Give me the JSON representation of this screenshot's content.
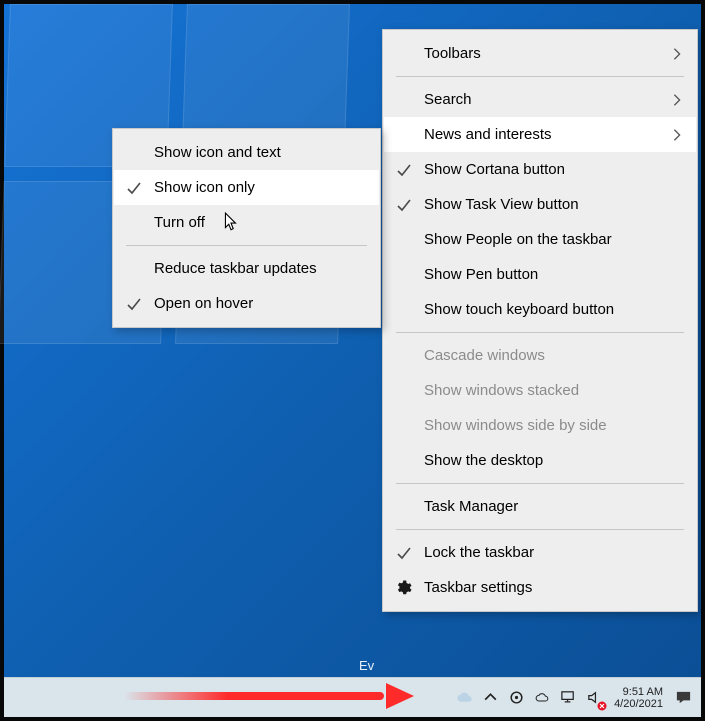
{
  "desktop": {
    "watermark": "Ev"
  },
  "taskbar": {
    "time": "9:51 AM",
    "date": "4/20/2021"
  },
  "mainMenu": {
    "toolbars": "Toolbars",
    "search": "Search",
    "newsInterests": "News and interests",
    "cortana": "Show Cortana button",
    "taskview": "Show Task View button",
    "people": "Show People on the taskbar",
    "pen": "Show Pen button",
    "touchkb": "Show touch keyboard button",
    "cascade": "Cascade windows",
    "stacked": "Show windows stacked",
    "sidebyside": "Show windows side by side",
    "showdesktop": "Show the desktop",
    "taskmgr": "Task Manager",
    "lock": "Lock the taskbar",
    "settings": "Taskbar settings"
  },
  "subMenu": {
    "iconText": "Show icon and text",
    "iconOnly": "Show icon only",
    "turnOff": "Turn off",
    "reduceUpdates": "Reduce taskbar updates",
    "openHover": "Open on hover"
  }
}
